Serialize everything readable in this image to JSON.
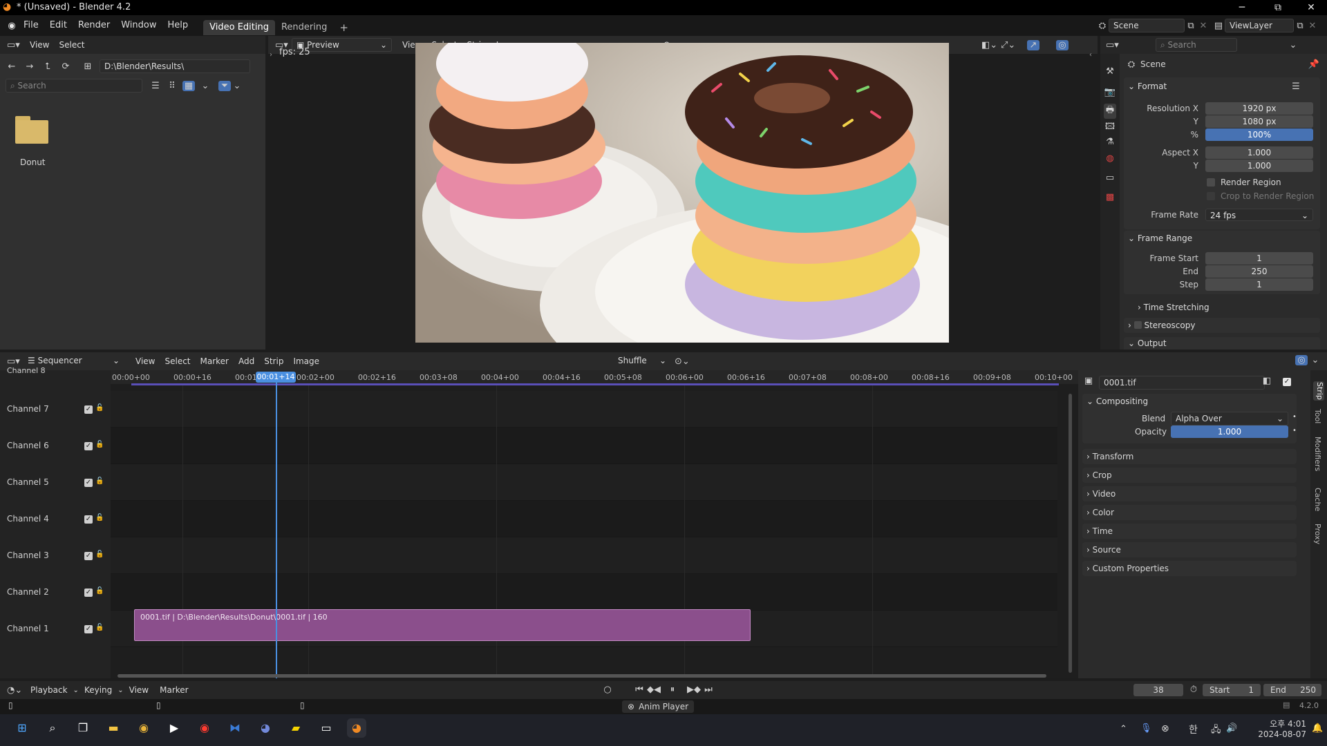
{
  "window": {
    "title": "* (Unsaved) - Blender 4.2",
    "minimize": "─",
    "maximize": "⧉",
    "close": "✕"
  },
  "menu": [
    "File",
    "Edit",
    "Render",
    "Window",
    "Help"
  ],
  "workspaces": {
    "active": "Video Editing",
    "other": "Rendering",
    "add": "+"
  },
  "scene": {
    "label": "Scene",
    "viewlayer": "ViewLayer"
  },
  "filebrowser": {
    "menu": [
      "View",
      "Select"
    ],
    "path": "D:\\Blender\\Results\\",
    "search_placeholder": "Search",
    "folder": "Donut"
  },
  "preview": {
    "mode": "Preview",
    "menu": [
      "View",
      "Select",
      "Strip",
      "Image"
    ],
    "fps": "fps: 25"
  },
  "properties": {
    "search_placeholder": "Search",
    "scene": "Scene",
    "format": {
      "title": "Format",
      "res_x_label": "Resolution X",
      "res_x": "1920 px",
      "res_y_label": "Y",
      "res_y": "1080 px",
      "pct_label": "%",
      "pct": "100%",
      "aspect_x_label": "Aspect X",
      "aspect_x": "1.000",
      "aspect_y_label": "Y",
      "aspect_y": "1.000",
      "render_region": "Render Region",
      "crop": "Crop to Render Region",
      "frame_rate_label": "Frame Rate",
      "frame_rate": "24 fps"
    },
    "frame_range": {
      "title": "Frame Range",
      "start_label": "Frame Start",
      "start": "1",
      "end_label": "End",
      "end": "250",
      "step_label": "Step",
      "step": "1"
    },
    "time_stretching": "Time Stretching",
    "stereoscopy": "Stereoscopy",
    "output": "Output"
  },
  "sequencer": {
    "mode": "Sequencer",
    "menu": [
      "View",
      "Select",
      "Marker",
      "Add",
      "Strip",
      "Image"
    ],
    "overlap": "Shuffle",
    "channel_top": "Channel 8",
    "channels": [
      "Channel 7",
      "Channel 6",
      "Channel 5",
      "Channel 4",
      "Channel 3",
      "Channel 2",
      "Channel 1"
    ],
    "ticks": [
      "00:00+00",
      "00:00+16",
      "00:01",
      "00:02+00",
      "00:02+16",
      "00:03+08",
      "00:04+00",
      "00:04+16",
      "00:05+08",
      "00:06+00",
      "00:06+16",
      "00:07+08",
      "00:08+00",
      "00:08+16",
      "00:09+08",
      "00:10+00"
    ],
    "playhead": "00:01+14",
    "strip": "0001.tif | D:\\Blender\\Results\\Donut\\0001.tif | 160"
  },
  "strip_panel": {
    "name": "0001.tif",
    "compositing": "Compositing",
    "blend_label": "Blend",
    "blend": "Alpha Over",
    "opacity_label": "Opacity",
    "opacity": "1.000",
    "sections": [
      "Transform",
      "Crop",
      "Video",
      "Color",
      "Time",
      "Source",
      "Custom Properties"
    ],
    "tabs": [
      "Strip",
      "Tool",
      "Modifiers",
      "Cache",
      "Proxy"
    ]
  },
  "timeline": {
    "menu": [
      "Playback",
      "Keying",
      "View",
      "Marker"
    ],
    "frame": "38",
    "start_label": "Start",
    "start": "1",
    "end_label": "End",
    "end": "250"
  },
  "status": {
    "anim_player": "Anim Player",
    "version": "4.2.0"
  },
  "taskbar": {
    "time": "오후 4:01",
    "date": "2024-08-07",
    "ime": "한"
  }
}
